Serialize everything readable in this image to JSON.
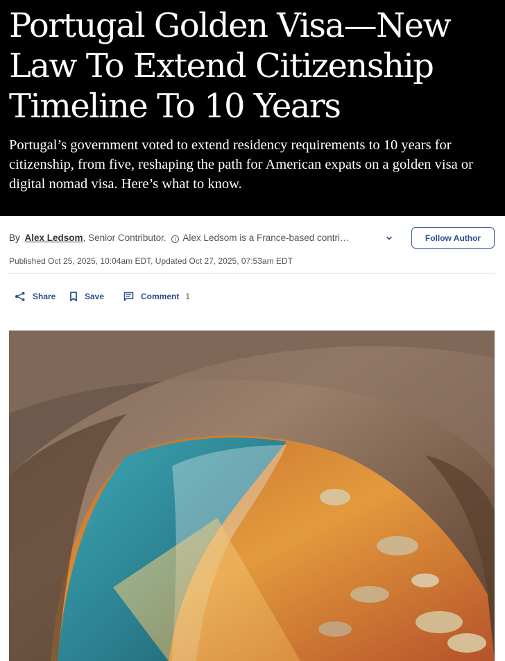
{
  "article": {
    "headline": "Portugal Golden Visa—New Law To Extend Citizenship Timeline To 10 Years",
    "dek": "Portugal’s government voted to extend residency requirements to 10 years for citizenship, from five, reshaping the path for American expats on a golden visa or digital nomad visa. Here’s what to know."
  },
  "byline": {
    "prefix": "By",
    "author": "Alex Ledsom",
    "role": ", Senior Contributor.",
    "info_icon": "info-icon",
    "bio": "Alex Ledsom is a France-based contri…",
    "follow_label": "Follow Author"
  },
  "dates": {
    "text": "Published Oct 25, 2025, 10:04am EDT, Updated Oct 27, 2025, 07:53am EDT"
  },
  "actions": {
    "share_label": "Share",
    "save_label": "Save",
    "comment_label": "Comment",
    "comment_count": "1"
  },
  "colors": {
    "hero_bg": "#000000",
    "link_blue": "#2c4f8f"
  }
}
